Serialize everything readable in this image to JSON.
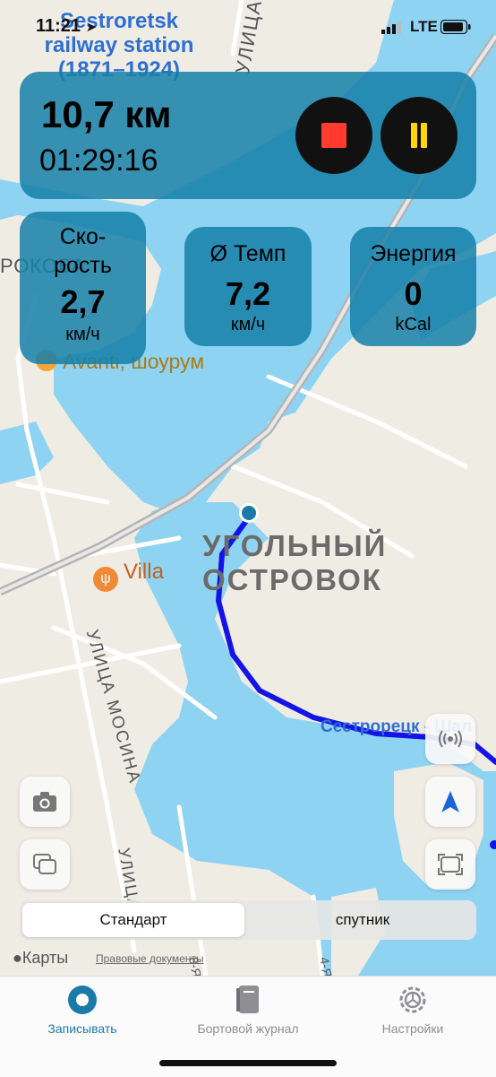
{
  "status_bar": {
    "time": "11:21",
    "network": "LTE"
  },
  "stats": {
    "distance": "10,7 км",
    "duration": "01:29:16",
    "speed": {
      "label": "Ско-\nрость",
      "value": "2,7",
      "unit": "км/ч"
    },
    "avg_pace": {
      "label": "Ø Темп",
      "value": "7,2",
      "unit": "км/ч"
    },
    "energy": {
      "label": "Энергия",
      "value": "0",
      "unit": "kCal"
    }
  },
  "map": {
    "station_label_1": "Sestroretsk",
    "station_label_2": "railway station",
    "station_label_3": "(1871–1924)",
    "street_vertical_top": "УЛИЦА",
    "street_left": "РОКОВА",
    "poi_avanti": "Avanti, шоурум",
    "poi_villa": "Villa",
    "area_label_1": "УГОЛЬНЫЙ",
    "area_label_2": "ОСТРОВОК",
    "street_mosina": "УЛИЦА МОСИНА",
    "street_bottom": "УЛИЦА",
    "road_label": "Сестрорецк - Шал",
    "street_8": "8-Я",
    "street_4": "4-Я"
  },
  "map_type": {
    "options": [
      "Стандарт",
      "спутник"
    ],
    "selected": "Стандарт"
  },
  "attribution": {
    "logo": "Карты",
    "legal": "Правовые документы"
  },
  "tabs": [
    {
      "label": "Записывать",
      "icon": "record-icon",
      "active": true
    },
    {
      "label": "Бортовой журнал",
      "icon": "logbook-icon",
      "active": false
    },
    {
      "label": "Настройки",
      "icon": "settings-icon",
      "active": false
    }
  ],
  "colors": {
    "water": "#8fd3f2",
    "land": "#efece4",
    "card": "#1680aa",
    "route": "#1414e6",
    "accent": "#1a7aa8"
  }
}
